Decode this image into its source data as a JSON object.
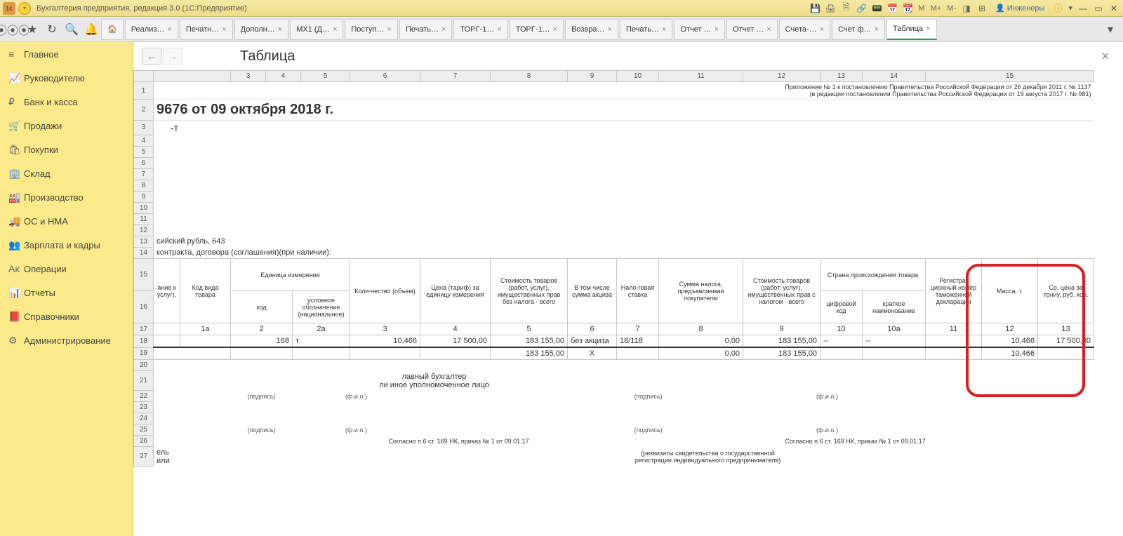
{
  "titlebar": {
    "logo_text": "1с",
    "title": "Бухгалтерия предприятия, редакция 3.0  (1С:Предприятие)",
    "m_btns": [
      "M",
      "M+",
      "M-"
    ],
    "user": "Инженеры"
  },
  "tabs": [
    {
      "label": "Реализ…"
    },
    {
      "label": "Печатн…"
    },
    {
      "label": "Дополн…"
    },
    {
      "label": "МХ1 (Д…"
    },
    {
      "label": "Поступ…"
    },
    {
      "label": "Печать…"
    },
    {
      "label": "ТОРГ-1…"
    },
    {
      "label": "ТОРГ-1…"
    },
    {
      "label": "Возвра…"
    },
    {
      "label": "Печать…"
    },
    {
      "label": "Отчет …"
    },
    {
      "label": "Отчет …"
    },
    {
      "label": "Счета-…"
    },
    {
      "label": "Счет ф…"
    },
    {
      "label": "Таблица",
      "active": true
    }
  ],
  "sidebar": [
    {
      "icon": "≡",
      "label": "Главное"
    },
    {
      "icon": "📈",
      "label": "Руководителю"
    },
    {
      "icon": "₽",
      "label": "Банк и касса"
    },
    {
      "icon": "🛒",
      "label": "Продажи"
    },
    {
      "icon": "🛍",
      "label": "Покупки"
    },
    {
      "icon": "🏢",
      "label": "Склад"
    },
    {
      "icon": "🏭",
      "label": "Производство"
    },
    {
      "icon": "🚚",
      "label": "ОС и НМА"
    },
    {
      "icon": "👥",
      "label": "Зарплата и кадры"
    },
    {
      "icon": "Аᴋ",
      "label": "Операции"
    },
    {
      "icon": "📊",
      "label": "Отчеты"
    },
    {
      "icon": "📕",
      "label": "Справочники"
    },
    {
      "icon": "⚙",
      "label": "Администрирование"
    }
  ],
  "doc": {
    "title": "Таблица"
  },
  "cols": [
    "",
    "3",
    "4",
    "5",
    "6",
    "7",
    "8",
    "9",
    "10",
    "11",
    "12",
    "13",
    "14",
    "15"
  ],
  "topnote1": "Приложение № 1 к постановлению Правительства Российской Федерации от 26 декабря 2011 г. № 1137",
  "topnote2": "(в редакции постановления Правительства Российской Федерации от 19 августа 2017 г. № 981)",
  "row2cell": "9676 от 09 октября 2018 г.",
  "row3cell": "-т",
  "row13": "сийский рубль, 643",
  "row14": "контракта, договора (соглашения)(при наличии):",
  "headers": {
    "h1": "ание к услуг),",
    "h2": "Код вида товара",
    "h3": "Единица измерения",
    "h3a": "код",
    "h3b": "условное обозначение (национальное)",
    "h4": "Коли-чество (объем)",
    "h5": "Цена (тариф) за единицу измерения",
    "h6": "Стоимость товаров (работ, услуг), имущественных прав без налога - всего",
    "h7": "В том числе сумма акциза",
    "h8": "Нало-говая ставка",
    "h9": "Сумма налога, предъявляемая покупателю",
    "h10": "Стоимость товаров (работ, услуг), имущественных прав с налогом - всего",
    "h11": "Страна происхождения товара",
    "h11a": "цифровой код",
    "h11b": "краткое наименование",
    "h12": "Регистра-ционный номер таможенной декларации",
    "h13": "Масса, т.",
    "h14": "Ср. цена за тонну, руб. коп."
  },
  "numrow": {
    "c1": "1а",
    "c2": "2",
    "c3": "2а",
    "c4": "3",
    "c5": "4",
    "c6": "5",
    "c7": "6",
    "c8": "7",
    "c9": "8",
    "c10": "9",
    "c11": "10",
    "c12": "10а",
    "c13": "11",
    "c14": "12",
    "c15": "13"
  },
  "data18": {
    "kod": "168",
    "ed": "т",
    "qty": "10,466",
    "price": "17 500,00",
    "sum": "183 155,00",
    "akc": "без акциза",
    "rate": "18/118",
    "tax": "0,00",
    "total": "183 155,00",
    "ccode": "--",
    "cname": "--",
    "mass": "10,466",
    "avg": "17 500,00"
  },
  "data19": {
    "sum": "183 155,00",
    "akc": "Х",
    "tax": "0,00",
    "total": "183 155,00",
    "mass": "10,466"
  },
  "sig": {
    "main_acc1": "лавный бухгалтер",
    "main_acc2": "ли иное уполномоченное лицо",
    "sign": "(подпись)",
    "fio": "(ф.и.о.)",
    "note": "Согласно п.6 ст. 169 НК, приказ  № 1 от 09.01.17",
    "ip_line1": "(реквизиты свидетельства о государственной",
    "ip_line2": "регистрации индивидуального предпринимателя)",
    "el_ili": "ель или"
  }
}
